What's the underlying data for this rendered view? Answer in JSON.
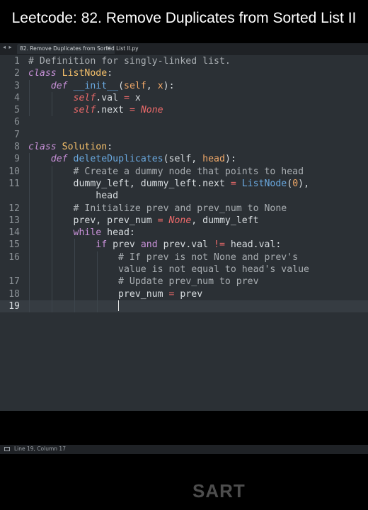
{
  "video_title": "Leetcode: 82. Remove Duplicates from Sorted List II",
  "tab": {
    "nav_arrows": "◂ ▸",
    "filename": "82. Remove Duplicates from Sorted List II.py",
    "close": "×"
  },
  "code": {
    "line_numbers": [
      "1",
      "2",
      "3",
      "4",
      "5",
      "6",
      "7",
      "8",
      "9",
      "10",
      "11",
      "",
      "12",
      "13",
      "14",
      "15",
      "16",
      "",
      "17",
      "18",
      "19"
    ],
    "current_line": "19"
  },
  "status": {
    "position": "Line 19, Column 17"
  },
  "watermark": "SART"
}
